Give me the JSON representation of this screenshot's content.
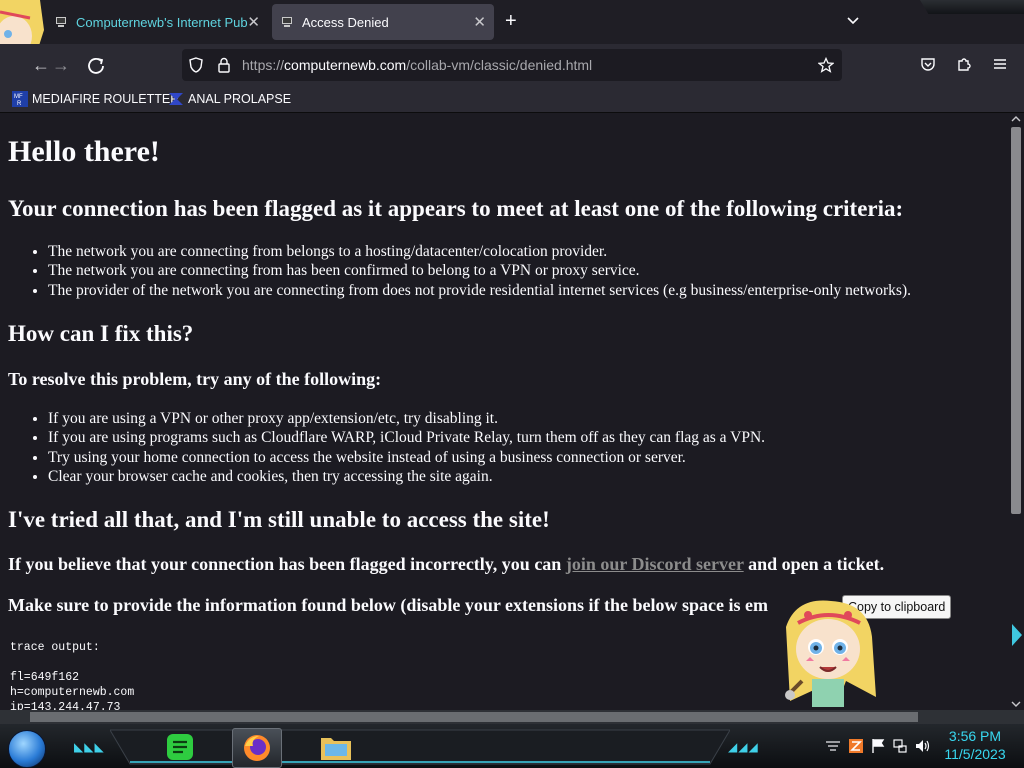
{
  "browser": {
    "tabs": [
      {
        "title": "Computernewb's Internet Pub",
        "active": false
      },
      {
        "title": "Access Denied",
        "active": true
      }
    ],
    "url": {
      "scheme": "https://",
      "host": "computernewb.com",
      "path": "/collab-vm/classic/denied.html"
    },
    "bookmarks": [
      {
        "label": "MEDIAFIRE ROULETTER",
        "icon": "mf-icon"
      },
      {
        "label": "ANAL PROLAPSE",
        "icon": "chevron-bookmark-icon"
      }
    ]
  },
  "page": {
    "heading": "Hello there!",
    "criteria_heading": "Your connection has been flagged as it appears to meet at least one of the following criteria:",
    "criteria": [
      "The network you are connecting from belongs to a hosting/datacenter/colocation provider.",
      "The network you are connecting from has been confirmed to belong to a VPN or proxy service.",
      "The provider of the network you are connecting from does not provide residential internet services (e.g business/enterprise-only networks)."
    ],
    "fix_heading": "How can I fix this?",
    "resolve_heading": "To resolve this problem, try any of the following:",
    "fixes": [
      "If you are using a VPN or other proxy app/extension/etc, try disabling it.",
      "If you are using programs such as Cloudflare WARP, iCloud Private Relay, turn them off as they can flag as a VPN.",
      "Try using your home connection to access the website instead of using a business connection or server.",
      "Clear your browser cache and cookies, then try accessing the site again."
    ],
    "still_heading": "I've tried all that, and I'm still unable to access the site!",
    "discord_before": "If you believe that your connection has been flagged incorrectly, you can ",
    "discord_link": "join our Discord server",
    "discord_after": " and open a ticket.",
    "provide_info": "Make sure to provide the information found below (disable your extensions if the below space is em",
    "copy_button": "Copy to clipboard",
    "trace": "trace output:\n\nfl=649f162\nh=computernewb.com\nip=143.244.47.73"
  },
  "taskbar": {
    "time": "3:56 PM",
    "date": "11/5/2023"
  },
  "colors": {
    "accent": "#38d8f0",
    "page_bg": "#1c1b22",
    "link": "#8c8c8c"
  }
}
